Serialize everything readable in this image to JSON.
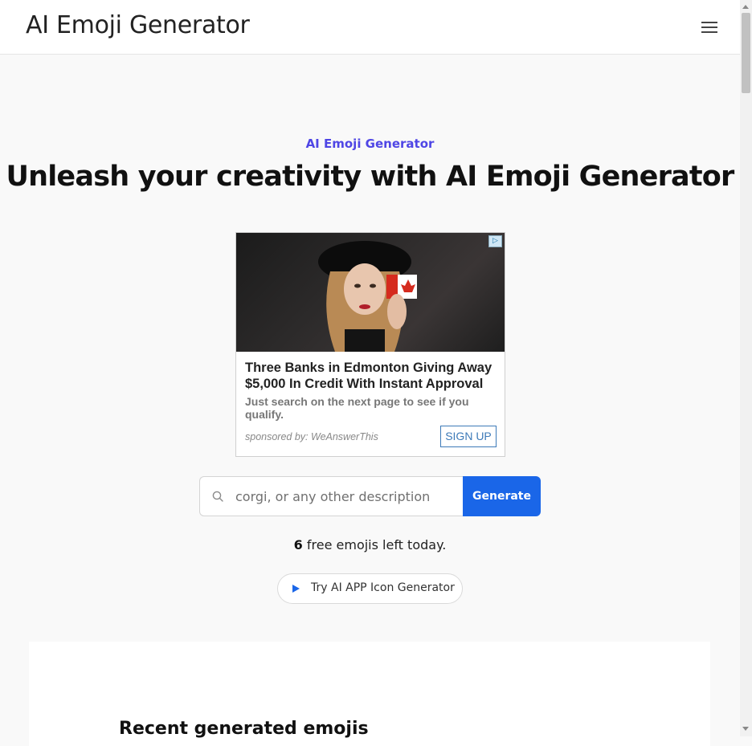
{
  "header": {
    "brand": "AI Emoji Generator",
    "menu_icon": "hamburger-menu-icon"
  },
  "hero": {
    "eyebrow": "AI Emoji Generator",
    "title": "Unleash your creativity with AI Emoji Generator"
  },
  "ad": {
    "badge_icon": "ad-choices-icon",
    "headline": "Three Banks in Edmonton Giving Away $5,000 In Credit With Instant Approval",
    "body": "Just search on the next page to see if you qualify.",
    "sponsor": "sponsored by: WeAnswerThis",
    "cta": "SIGN UP"
  },
  "search": {
    "icon": "search-icon",
    "placeholder": "corgi, or any other description",
    "value": "",
    "button": "Generate"
  },
  "quota": {
    "count": "6",
    "text": "free emojis left today."
  },
  "promo": {
    "icon": "play-icon",
    "label": "Try AI APP Icon Generator"
  },
  "recent": {
    "title": "Recent generated emojis"
  },
  "colors": {
    "accent": "#1a66e8",
    "eyebrow": "#4f46e5",
    "page_bg": "#f9f9f9"
  }
}
